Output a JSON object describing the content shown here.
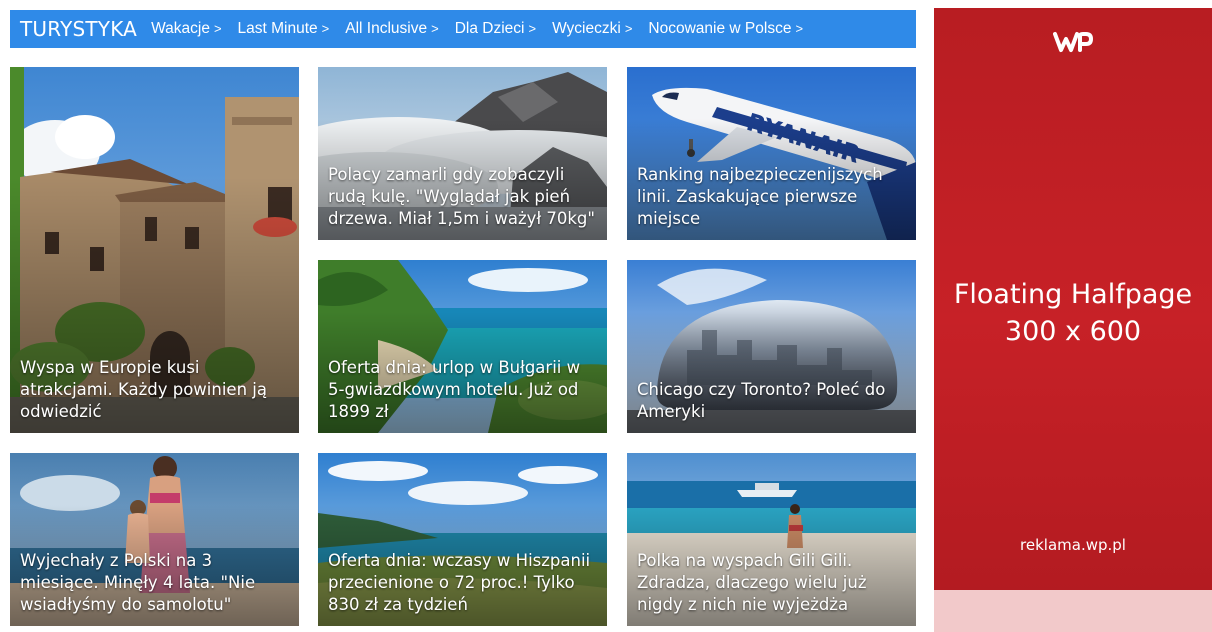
{
  "nav": {
    "title": "TURYSTYKA",
    "chevron": ">",
    "links": [
      "Wakacje",
      "Last Minute",
      "All Inclusive",
      "Dla Dzieci",
      "Wycieczki",
      "Nocowanie w Polsce"
    ]
  },
  "tiles": [
    {
      "caption": "Wyspa w Europie kusi atrakcjami. Każdy powinien ją odwiedzić"
    },
    {
      "caption": "Polacy zamarli gdy zobaczyli rudą kulę. \"Wyglądał jak pień drzewa. Miał 1,5m i ważył 70kg\""
    },
    {
      "caption": "Ranking najbezpieczenijszych linii. Zaskakujące pierwsze miejsce"
    },
    {
      "caption": "Oferta dnia: urlop w Bułgarii w 5-gwiazdkowym hotelu. Już od 1899 zł"
    },
    {
      "caption": "Chicago czy Toronto? Poleć do Ameryki"
    },
    {
      "caption": "Wyjechały z Polski na 3 miesiące. Minęły 4 lata. \"Nie wsiadłyśmy do samolotu\""
    },
    {
      "caption": "Oferta dnia: wczasy w Hiszpanii przecienione o 72 proc.! Tylko 830 zł za tydzień"
    },
    {
      "caption": "Polka na wyspach Gili Gili. Zdradza, dlaczego wielu już nigdy z nich nie wyjeżdża"
    }
  ],
  "airline_text": "RYANAIR",
  "ad": {
    "logo": "WP",
    "headline_line1": "Floating Halfpage",
    "headline_line2": "300 x 600",
    "url": "reklama.wp.pl"
  },
  "colors": {
    "nav_bg": "#2f8ae8",
    "ad_bg": "#c72127",
    "ad_strip": "#f2c9ca"
  }
}
